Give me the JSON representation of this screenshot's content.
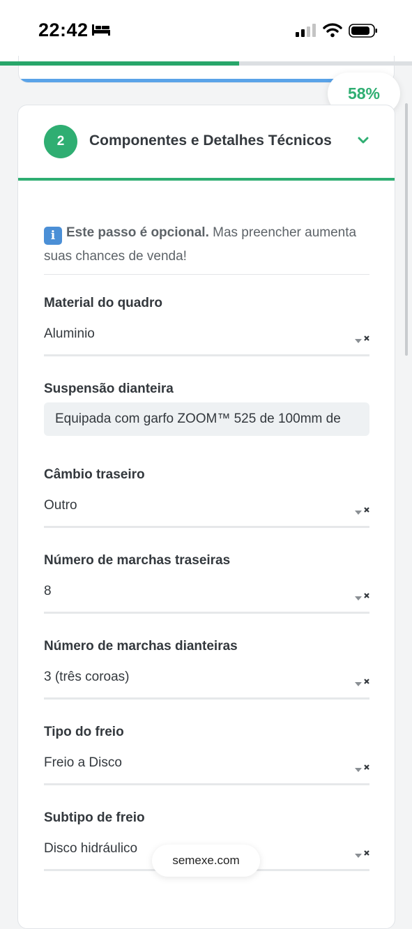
{
  "status_bar": {
    "time": "22:42"
  },
  "progress": {
    "fraction": 0.58,
    "label": "58%"
  },
  "section": {
    "step_number": "2",
    "title": "Componentes e Detalhes Técnicos"
  },
  "notice": {
    "bold": "Este passo é opcional.",
    "text": " Mas preencher aumenta suas chances de venda!"
  },
  "fields": [
    {
      "label": "Material do quadro",
      "value": "Aluminio"
    },
    {
      "label": "Suspensão dianteira",
      "value": "Equipada com garfo ZOOM™ 525 de 100mm de"
    },
    {
      "label": "Câmbio traseiro",
      "value": "Outro"
    },
    {
      "label": "Número de marchas traseiras",
      "value": "8"
    },
    {
      "label": "Número de marchas dianteiras",
      "value": "3 (três coroas)"
    },
    {
      "label": "Tipo do freio",
      "value": "Freio a Disco"
    },
    {
      "label": "Subtipo de freio",
      "value": "Disco hidráulico"
    }
  ],
  "browser": {
    "url": "semexe.com"
  },
  "colors": {
    "accent": "#2fae72",
    "info": "#4b8fd6",
    "prev_bar": "#5aa3e8"
  },
  "icons": [
    "sleep-bed-icon",
    "cellular-signal-icon",
    "wifi-icon",
    "battery-icon",
    "chevron-down-icon",
    "info-icon",
    "select-arrow-clear-icon"
  ]
}
